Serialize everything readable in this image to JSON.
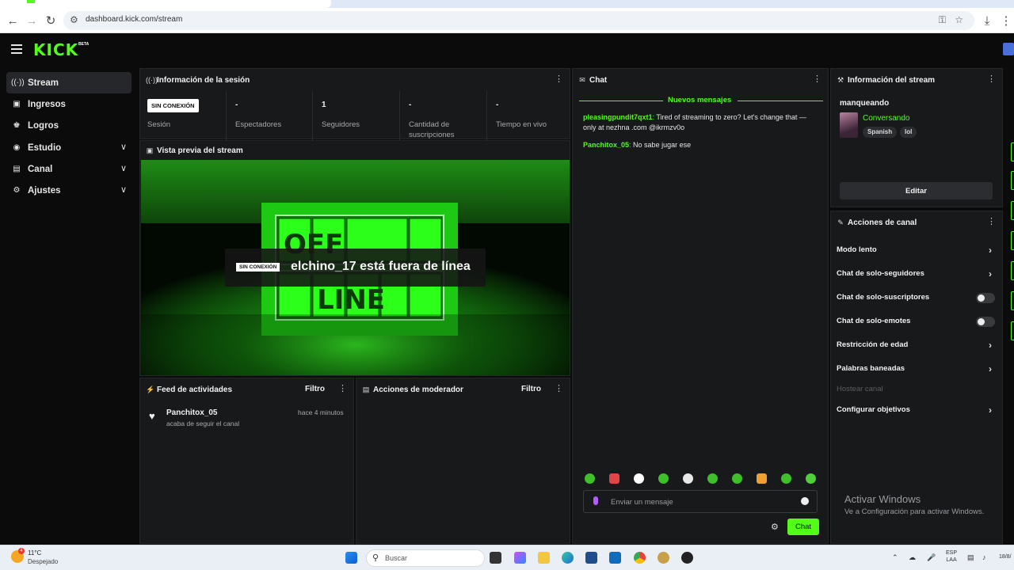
{
  "browser": {
    "url": "dashboard.kick.com/stream"
  },
  "topbar": {
    "logo": "KICK",
    "logo_badge": "BETA"
  },
  "sidebar": {
    "items": [
      {
        "label": "Stream",
        "icon": "broadcast-icon"
      },
      {
        "label": "Ingresos",
        "icon": "money-icon"
      },
      {
        "label": "Logros",
        "icon": "trophy-icon"
      },
      {
        "label": "Estudio",
        "icon": "studio-icon"
      },
      {
        "label": "Canal",
        "icon": "channel-icon"
      },
      {
        "label": "Ajustes",
        "icon": "gear-icon"
      }
    ]
  },
  "session": {
    "title": "Información de la sesión",
    "status_badge": "SIN CONEXIÓN",
    "status_label": "Sesión",
    "stats": [
      {
        "value": "-",
        "label": "Espectadores"
      },
      {
        "value": "1",
        "label": "Seguidores"
      },
      {
        "value": "-",
        "label": "Cantidad de suscripciones"
      },
      {
        "value": "-",
        "label": "Tiempo en vivo"
      }
    ]
  },
  "preview": {
    "title": "Vista previa del stream",
    "badge": "SIN CONEXIÓN",
    "message": "elchino_17 está fuera de línea",
    "sign_top": "OFF",
    "sign_bottom": "LINE"
  },
  "feed": {
    "title": "Feed de actividades",
    "filter": "Filtro",
    "items": [
      {
        "user": "Panchitox_05",
        "action": "acaba de seguir el canal",
        "time": "hace 4 minutos"
      }
    ]
  },
  "moderator": {
    "title": "Acciones de moderador",
    "filter": "Filtro"
  },
  "chat": {
    "title": "Chat",
    "new_messages": "Nuevos mensajes",
    "messages": [
      {
        "user": "pleasingpundit7qxt1",
        "text": " Tired of streaming to zero? Let's change that — only at nezhna .com @ikrmzv0o"
      },
      {
        "user": "Panchitox_05",
        "text": " No sabe jugar ese"
      }
    ],
    "input_placeholder": "Enviar un mensaje",
    "send_label": "Chat"
  },
  "stream_info": {
    "title": "Información del stream",
    "stream_title": "manqueando",
    "category": "Conversando",
    "tags": [
      "Spanish",
      "lol"
    ],
    "edit_label": "Editar"
  },
  "channel_actions": {
    "title": "Acciones de canal",
    "items": [
      {
        "label": "Modo lento",
        "control": "arrow"
      },
      {
        "label": "Chat de solo-seguidores",
        "control": "arrow"
      },
      {
        "label": "Chat de solo-suscriptores",
        "control": "toggle"
      },
      {
        "label": "Chat de solo-emotes",
        "control": "toggle"
      },
      {
        "label": "Restricción de edad",
        "control": "arrow"
      },
      {
        "label": "Palabras baneadas",
        "control": "arrow"
      },
      {
        "label": "Hostear canal",
        "control": "none"
      },
      {
        "label": "Configurar objetivos",
        "control": "arrow"
      }
    ]
  },
  "watermark": {
    "line1": "Activar Windows",
    "line2": "Ve a Configuración para activar Windows."
  },
  "taskbar": {
    "temperature": "11°C",
    "condition": "Despejado",
    "weather_badge": "4",
    "search_placeholder": "Buscar",
    "lang_top": "ESP",
    "lang_bottom": "LAA",
    "date": "18/8/"
  },
  "colors": {
    "accent": "#53fc18",
    "panel": "#18191b",
    "background": "#0b0b0c"
  }
}
